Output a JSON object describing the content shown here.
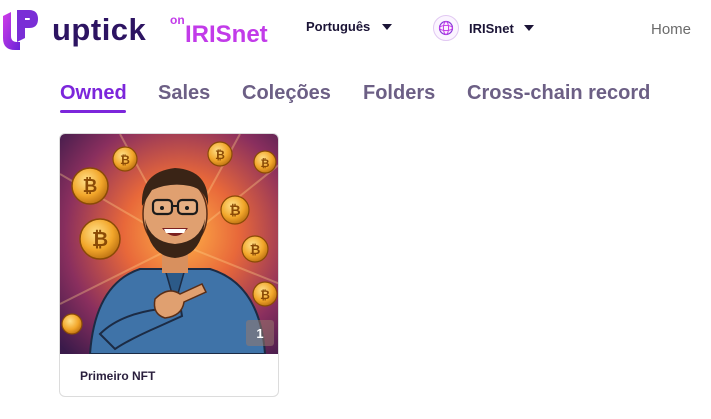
{
  "header": {
    "logo_word": "uptick",
    "logo_on": "on",
    "logo_network": "IRISnet",
    "language": "Português",
    "chain": "IRISnet",
    "home": "Home"
  },
  "tabs": [
    {
      "label": "Owned",
      "active": true
    },
    {
      "label": "Sales",
      "active": false
    },
    {
      "label": "Coleções",
      "active": false
    },
    {
      "label": "Folders",
      "active": false
    },
    {
      "label": "Cross-chain record",
      "active": false
    }
  ],
  "nfts": [
    {
      "title": "Primeiro NFT",
      "count": "1"
    }
  ],
  "colors": {
    "brand_dark": "#2d1462",
    "brand_pink": "#c23be9",
    "tab_active": "#7c26db",
    "tab_inactive": "#6c5f85"
  }
}
